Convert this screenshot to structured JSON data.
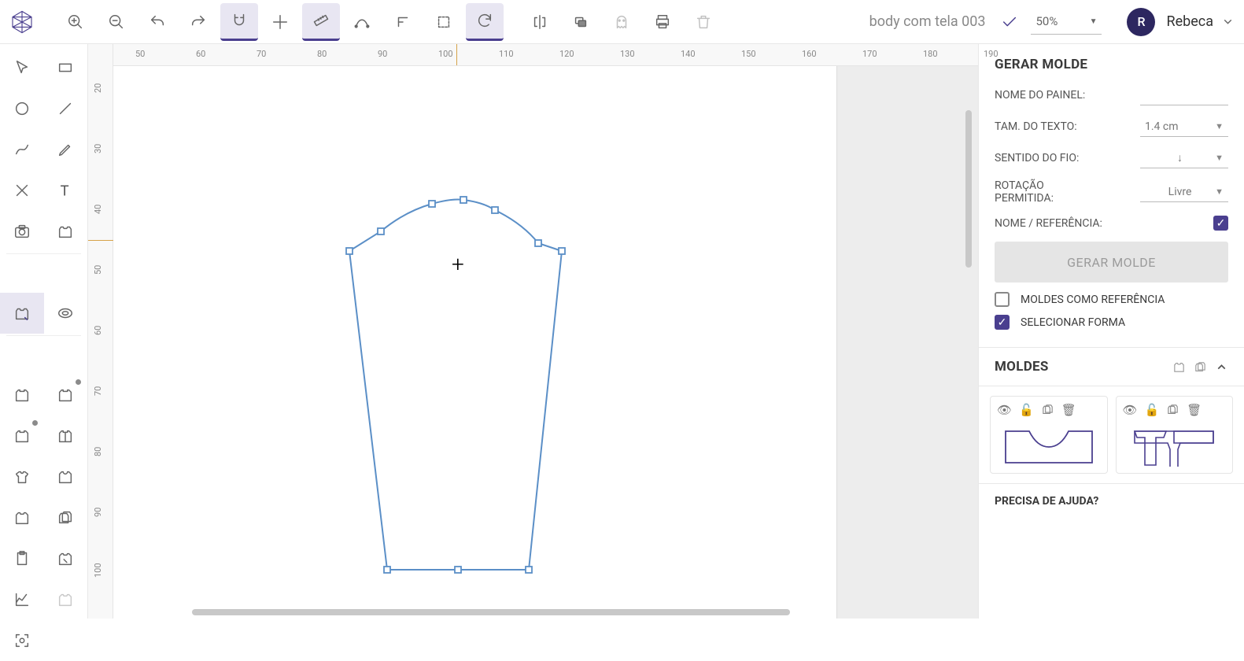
{
  "doc_name": "body com tela 003",
  "zoom": "50%",
  "user": {
    "initial": "R",
    "name": "Rebeca"
  },
  "hruler_ticks": [
    50,
    60,
    70,
    80,
    90,
    100,
    110,
    120,
    130,
    140,
    150,
    160,
    170,
    180,
    190
  ],
  "vruler_ticks": [
    20,
    30,
    40,
    50,
    60,
    70,
    80,
    90,
    100
  ],
  "rpanel": {
    "title": "GERAR MOLDE",
    "nome_painel_label": "NOME DO PAINEL:",
    "tam_texto_label": "TAM. DO TEXTO:",
    "tam_texto_value": "1.4 cm",
    "sentido_fio_label": "SENTIDO DO FIO:",
    "sentido_fio_value": "↓",
    "rotacao_label": "ROTAÇÃO PERMITIDA:",
    "rotacao_value": "Livre",
    "nome_ref_label": "NOME / REFERÊNCIA:",
    "gerar_btn": "GERAR MOLDE",
    "moldes_ref": "MOLDES COMO REFERÊNCIA",
    "selecionar_forma": "SELECIONAR FORMA",
    "moldes_title": "MOLDES",
    "help": "PRECISA DE AJUDA?"
  }
}
